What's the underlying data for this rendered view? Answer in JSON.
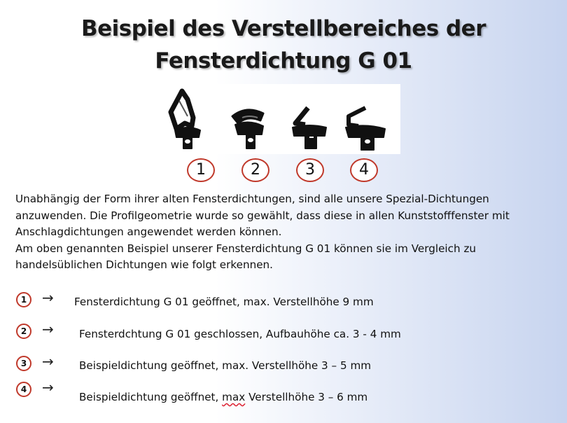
{
  "title": {
    "line1": "Beispiel des Verstellbereiches der",
    "line2": "Fensterdichtung G 01"
  },
  "figure_labels": [
    "1",
    "2",
    "3",
    "4"
  ],
  "paragraph": {
    "line1": "Unabhängig der Form ihrer alten Fensterdichtungen, sind alle unsere Spezial-Dichtungen",
    "line2": "anzuwenden. Die Profilgeometrie wurde so gewählt, dass diese in allen Kunststofffenster mit",
    "line3": "Anschlagdichtungen angewendet werden können.",
    "line4": "Am oben genannten Beispiel unserer Fensterdichtung G 01 können sie im Vergleich zu",
    "line5": "handelsüblichen Dichtungen wie folgt erkennen."
  },
  "legend": [
    {
      "num": "1",
      "arrow": "→",
      "text": "Fensterdichtung G 01 geöffnet, max. Verstellhöhe 9 mm"
    },
    {
      "num": "2",
      "arrow": "→",
      "text": "Fensterdchtung G 01 geschlossen, Aufbauhöhe ca. 3 - 4 mm"
    },
    {
      "num": "3",
      "arrow": "→",
      "text": "Beispieldichtung geöffnet, max. Verstellhöhe  3 – 5 mm"
    },
    {
      "num": "4",
      "arrow": "→",
      "text_before": "Beispieldichtung geöffnet, ",
      "text_marked": "max",
      "text_after": " Verstellhöhe 3 – 6 mm"
    }
  ],
  "colors": {
    "circle_border": "#c0392b",
    "seal_profile": "#111111"
  }
}
